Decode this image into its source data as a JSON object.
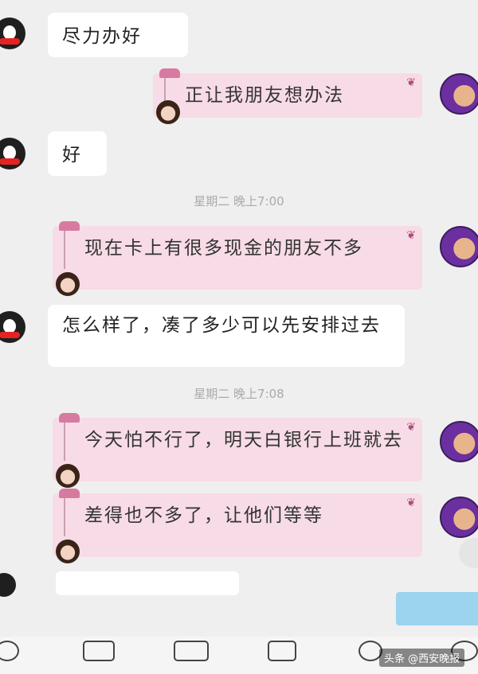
{
  "messages": [
    {
      "side": "left",
      "text": "尽力办好"
    },
    {
      "side": "right",
      "text": "正让我朋友想办法"
    },
    {
      "side": "left",
      "text": "好"
    },
    {
      "type": "time",
      "text": "星期二 晚上7:00"
    },
    {
      "side": "right",
      "text": "现在卡上有很多现金的朋友不多"
    },
    {
      "side": "left",
      "text": "怎么样了，凑了多少可以先安排过去"
    },
    {
      "type": "time",
      "text": "星期二 晚上7:08"
    },
    {
      "side": "right",
      "text": "今天怕不行了，明天白银行上班就去"
    },
    {
      "side": "right",
      "text": "差得也不多了，让他们等等"
    }
  ],
  "watermark": "头条 @西安晚报",
  "icons": {
    "left_avatar": "qq-penguin-avatar-icon",
    "right_avatar": "anime-character-avatar-icon",
    "toolbar": [
      "voice-icon",
      "image-icon",
      "camera-icon",
      "file-icon",
      "emoji-icon",
      "plus-icon"
    ]
  }
}
